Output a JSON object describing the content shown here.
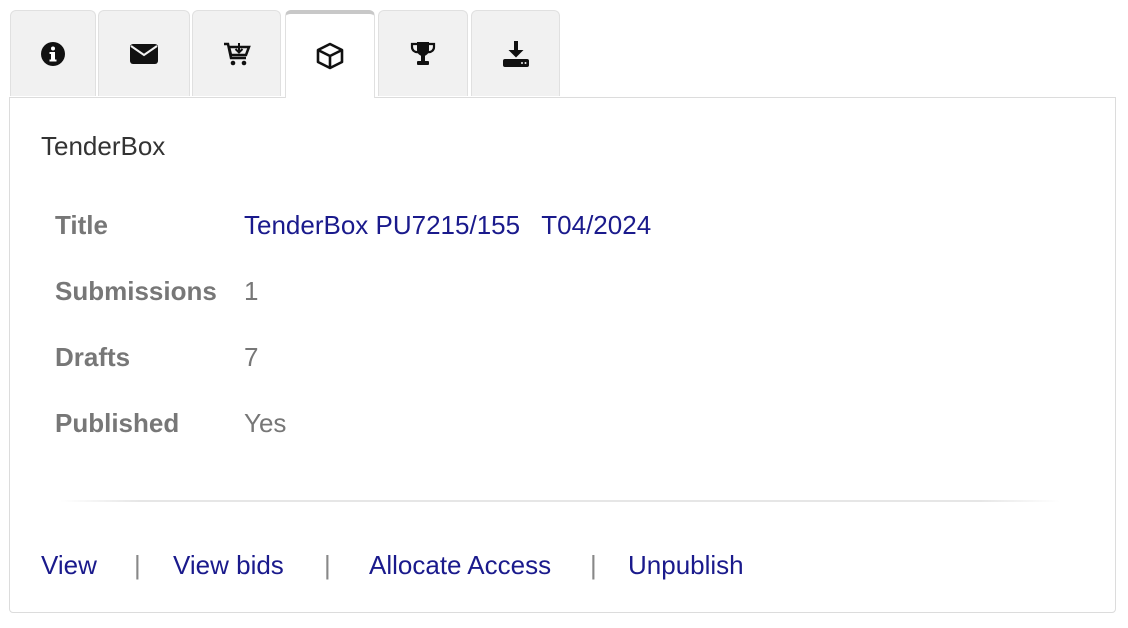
{
  "tabs": [
    {
      "icon": "info-icon",
      "active": false
    },
    {
      "icon": "envelope-icon",
      "active": false
    },
    {
      "icon": "cart-download-icon",
      "active": false
    },
    {
      "icon": "cube-icon",
      "active": true
    },
    {
      "icon": "trophy-icon",
      "active": false
    },
    {
      "icon": "download-icon",
      "active": false
    }
  ],
  "panel": {
    "title": "TenderBox",
    "details": [
      {
        "label": "Title",
        "value": "TenderBox PU7215/155   T04/2024"
      },
      {
        "label": "Submissions",
        "value": "1"
      },
      {
        "label": "Drafts",
        "value": "7"
      },
      {
        "label": "Published",
        "value": "Yes"
      }
    ],
    "actions": {
      "view": "View",
      "view_bids": "View bids",
      "allocate_access": "Allocate Access",
      "unpublish": "Unpublish",
      "separator": "|"
    }
  }
}
